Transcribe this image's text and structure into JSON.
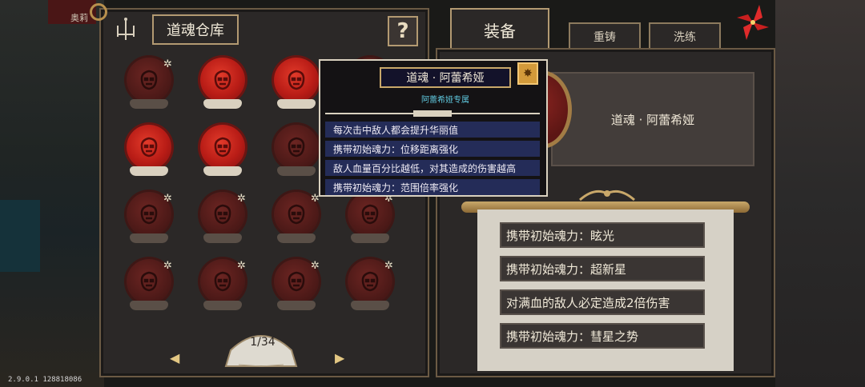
{
  "version": "2.9.0.1 128818086",
  "background_name": "奥莉",
  "left_panel": {
    "title": "道魂仓库",
    "help_label": "?",
    "pager": {
      "text": "1/34",
      "prev": "◀",
      "next": "▶"
    },
    "orbs": [
      {
        "state": "dim",
        "star": true
      },
      {
        "state": "active",
        "star": false
      },
      {
        "state": "active",
        "star": false
      },
      {
        "state": "dim",
        "star": false
      },
      {
        "state": "active",
        "star": false
      },
      {
        "state": "active",
        "star": false
      },
      {
        "state": "dim",
        "star": false
      },
      {
        "state": "dim",
        "star": false
      },
      {
        "state": "dim",
        "star": true
      },
      {
        "state": "dim",
        "star": true
      },
      {
        "state": "dim",
        "star": true
      },
      {
        "state": "dim",
        "star": true
      },
      {
        "state": "dim",
        "star": true
      },
      {
        "state": "dim",
        "star": true
      },
      {
        "state": "dim",
        "star": true
      },
      {
        "state": "dim",
        "star": true
      }
    ]
  },
  "right_panel": {
    "tabs": {
      "equip": "装备",
      "rebuild": "重铸",
      "wash": "洗练"
    },
    "selected_name": "道魂 · 阿蕾希娅",
    "effects": [
      "携带初始魂力：眩光",
      "携带初始魂力：超新星",
      "对满血的敌人必定造成2倍伤害",
      "携带初始魂力：彗星之势"
    ]
  },
  "tooltip": {
    "title": "道魂 · 阿蕾希娅",
    "subtitle": "阿蕾希娅专属",
    "badge": "✸",
    "lines": [
      "每次击中敌人都会提升华丽值",
      "携带初始魂力：位移距离强化",
      "敌人血量百分比越低，对其造成的伤害越高",
      "携带初始魂力：范围倍率强化"
    ]
  },
  "colors": {
    "accent_gold": "#c9a86a",
    "orb_active": "#c81f18",
    "tooltip_line": "#242c58",
    "subtitle_cyan": "#5fc7dd"
  }
}
